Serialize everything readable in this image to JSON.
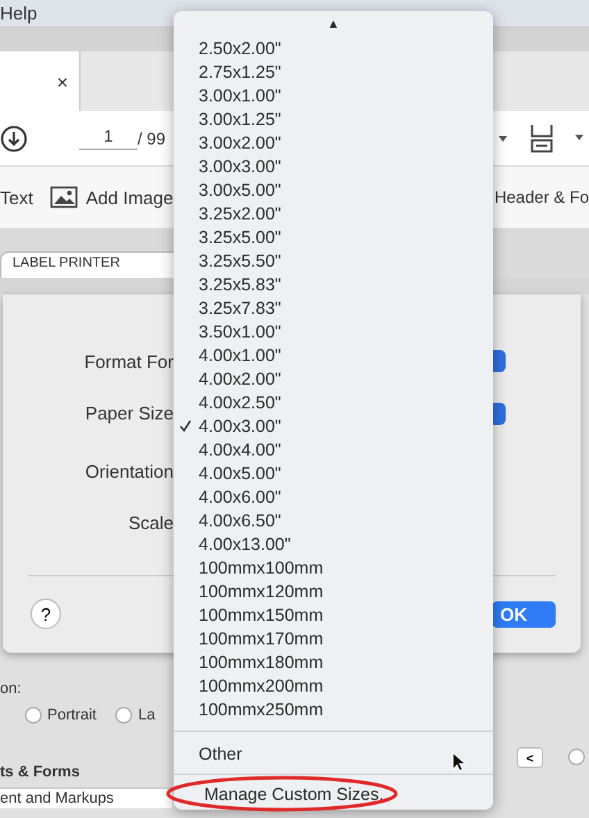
{
  "menubar": {
    "items": [
      "Help"
    ]
  },
  "document_tab": {
    "close": "×"
  },
  "toolbar": {
    "page": "1",
    "page_total": "/ 99"
  },
  "toolbar2": {
    "items": [
      {
        "label": "Text",
        "kind": "plain"
      },
      {
        "label": "Add Image",
        "kind": "image"
      },
      {
        "label": "Header & Fo",
        "kind": "plain"
      }
    ]
  },
  "printer_tab": {
    "label": "LABEL PRINTER"
  },
  "dialog": {
    "fields": [
      {
        "label": "Format For"
      },
      {
        "label": "Paper Size"
      },
      {
        "label": "Orientation"
      },
      {
        "label": "Scale"
      }
    ],
    "help": "?",
    "ok": "OK"
  },
  "options": {
    "label": "on:",
    "radios": [
      {
        "label": "Portrait",
        "selected": false
      },
      {
        "label": "La",
        "selected": false
      }
    ]
  },
  "section": {
    "title": "ts & Forms",
    "field_value": "ent and Markups"
  },
  "nav": {
    "back": "<",
    "radio_selected": false
  },
  "popup": {
    "scroll_up": "▲",
    "items": [
      {
        "label": "2.50x2.00\"",
        "checked": false
      },
      {
        "label": "2.75x1.25\"",
        "checked": false
      },
      {
        "label": "3.00x1.00\"",
        "checked": false
      },
      {
        "label": "3.00x1.25\"",
        "checked": false
      },
      {
        "label": "3.00x2.00\"",
        "checked": false
      },
      {
        "label": "3.00x3.00\"",
        "checked": false
      },
      {
        "label": "3.00x5.00\"",
        "checked": false
      },
      {
        "label": "3.25x2.00\"",
        "checked": false
      },
      {
        "label": "3.25x5.00\"",
        "checked": false
      },
      {
        "label": "3.25x5.50\"",
        "checked": false
      },
      {
        "label": "3.25x5.83\"",
        "checked": false
      },
      {
        "label": "3.25x7.83\"",
        "checked": false
      },
      {
        "label": "3.50x1.00\"",
        "checked": false
      },
      {
        "label": "4.00x1.00\"",
        "checked": false
      },
      {
        "label": "4.00x2.00\"",
        "checked": false
      },
      {
        "label": "4.00x2.50\"",
        "checked": false
      },
      {
        "label": "4.00x3.00\"",
        "checked": true
      },
      {
        "label": "4.00x4.00\"",
        "checked": false
      },
      {
        "label": "4.00x5.00\"",
        "checked": false
      },
      {
        "label": "4.00x6.00\"",
        "checked": false
      },
      {
        "label": "4.00x6.50\"",
        "checked": false
      },
      {
        "label": "4.00x13.00\"",
        "checked": false
      },
      {
        "label": "100mmx100mm",
        "checked": false
      },
      {
        "label": "100mmx120mm",
        "checked": false
      },
      {
        "label": "100mmx150mm",
        "checked": false
      },
      {
        "label": "100mmx170mm",
        "checked": false
      },
      {
        "label": "100mmx180mm",
        "checked": false
      },
      {
        "label": "100mmx200mm",
        "checked": false
      },
      {
        "label": "100mmx250mm",
        "checked": false
      }
    ],
    "other": "Other",
    "manage": "Manage Custom Sizes..."
  }
}
